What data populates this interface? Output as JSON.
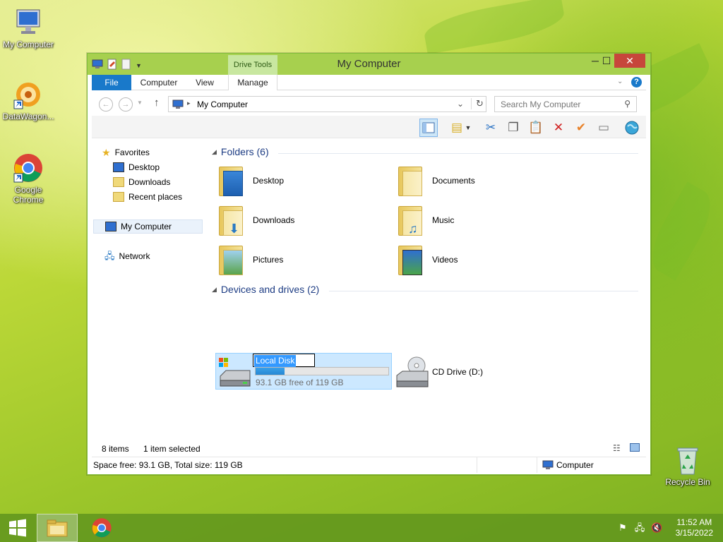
{
  "desktop": {
    "icons": [
      {
        "label": "My Computer"
      },
      {
        "label": "DataWagon..."
      },
      {
        "label": "Google Chrome"
      },
      {
        "label": "Recycle Bin"
      }
    ]
  },
  "window": {
    "title": "My Computer",
    "context_tab_header": "Drive Tools",
    "ribbon_tabs": [
      "File",
      "Computer",
      "View",
      "Manage"
    ],
    "address": "My Computer",
    "search_placeholder": "Search My Computer"
  },
  "nav": {
    "favorites": "Favorites",
    "desktop": "Desktop",
    "downloads": "Downloads",
    "recent": "Recent places",
    "my_computer": "My Computer",
    "network": "Network"
  },
  "content": {
    "folders_header": "Folders (6)",
    "folders": [
      {
        "name": "Desktop"
      },
      {
        "name": "Documents"
      },
      {
        "name": "Downloads"
      },
      {
        "name": "Music"
      },
      {
        "name": "Pictures"
      },
      {
        "name": "Videos"
      }
    ],
    "drives_header": "Devices and drives (2)",
    "drives": [
      {
        "name": "Local Disk",
        "free_text": "93.1 GB free of 119 GB",
        "used_fraction": 0.22
      },
      {
        "name": "CD Drive (D:)"
      }
    ]
  },
  "status": {
    "items": "8 items",
    "selected": "1 item selected",
    "space": "Space free: 93.1 GB, Total size: 119 GB",
    "location": "Computer"
  },
  "taskbar": {
    "time": "11:52 AM",
    "date": "3/15/2022"
  },
  "colors": {
    "accent": "#1979ca",
    "titlebar": "#a7d04e",
    "selection": "#cce8ff"
  }
}
